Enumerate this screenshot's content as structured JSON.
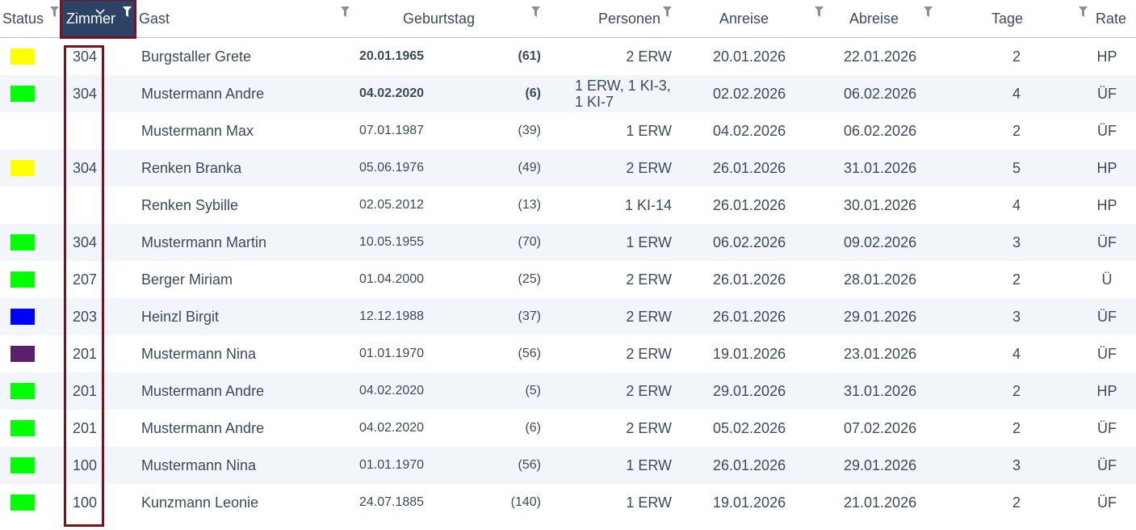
{
  "columns": {
    "status": "Status",
    "zimmer": "Zimmer",
    "gast": "Gast",
    "geburtstag": "Geburtstag",
    "personen": "Personen",
    "anreise": "Anreise",
    "abreise": "Abreise",
    "tage": "Tage",
    "rate": "Rate"
  },
  "icons": {
    "filter": "filter-icon",
    "sort": "chevron-down-icon"
  },
  "colors": {
    "header_active_bg": "#2b4466",
    "highlight_border": "#7a1020",
    "row_alt_bg": "#f2f5fa",
    "text": "#3c4a5c"
  },
  "rows": [
    {
      "status_color": "#ffff00",
      "zimmer": "304",
      "gast": "Burgstaller Grete",
      "geburtstag": "20.01.1965",
      "alter": "(61)",
      "personen": "2 ERW",
      "anreise": "20.01.2026",
      "abreise": "22.01.2026",
      "tage": "2",
      "rate": "HP",
      "bold": true
    },
    {
      "status_color": "#00ff00",
      "zimmer": "304",
      "gast": "Mustermann Andre",
      "geburtstag": "04.02.2020",
      "alter": "(6)",
      "personen": "1 ERW, 1 KI-3, 1 KI-7",
      "anreise": "02.02.2026",
      "abreise": "06.02.2026",
      "tage": "4",
      "rate": "ÜF",
      "bold": true
    },
    {
      "status_color": "",
      "zimmer": "",
      "gast": "Mustermann Max",
      "geburtstag": "07.01.1987",
      "alter": "(39)",
      "personen": "1 ERW",
      "anreise": "04.02.2026",
      "abreise": "06.02.2026",
      "tage": "2",
      "rate": "ÜF",
      "bold": false
    },
    {
      "status_color": "#ffff00",
      "zimmer": "304",
      "gast": "Renken Branka",
      "geburtstag": "05.06.1976",
      "alter": "(49)",
      "personen": "2 ERW",
      "anreise": "26.01.2026",
      "abreise": "31.01.2026",
      "tage": "5",
      "rate": "HP",
      "bold": false
    },
    {
      "status_color": "",
      "zimmer": "",
      "gast": "Renken Sybille",
      "geburtstag": "02.05.2012",
      "alter": "(13)",
      "personen": "1 KI-14",
      "anreise": "26.01.2026",
      "abreise": "30.01.2026",
      "tage": "4",
      "rate": "HP",
      "bold": false
    },
    {
      "status_color": "#00ff00",
      "zimmer": "304",
      "gast": "Mustermann Martin",
      "geburtstag": "10.05.1955",
      "alter": "(70)",
      "personen": "1 ERW",
      "anreise": "06.02.2026",
      "abreise": "09.02.2026",
      "tage": "3",
      "rate": "ÜF",
      "bold": false
    },
    {
      "status_color": "#00ff00",
      "zimmer": "207",
      "gast": "Berger Miriam",
      "geburtstag": "01.04.2000",
      "alter": "(25)",
      "personen": "2 ERW",
      "anreise": "26.01.2026",
      "abreise": "28.01.2026",
      "tage": "2",
      "rate": "Ü",
      "bold": false
    },
    {
      "status_color": "#0000ff",
      "zimmer": "203",
      "gast": "Heinzl Birgit",
      "geburtstag": "12.12.1988",
      "alter": "(37)",
      "personen": "2 ERW",
      "anreise": "26.01.2026",
      "abreise": "29.01.2026",
      "tage": "3",
      "rate": "ÜF",
      "bold": false
    },
    {
      "status_color": "#5c1f6e",
      "zimmer": "201",
      "gast": "Mustermann Nina",
      "geburtstag": "01.01.1970",
      "alter": "(56)",
      "personen": "2 ERW",
      "anreise": "19.01.2026",
      "abreise": "23.01.2026",
      "tage": "4",
      "rate": "ÜF",
      "bold": false
    },
    {
      "status_color": "#00ff00",
      "zimmer": "201",
      "gast": "Mustermann Andre",
      "geburtstag": "04.02.2020",
      "alter": "(5)",
      "personen": "2 ERW",
      "anreise": "29.01.2026",
      "abreise": "31.01.2026",
      "tage": "2",
      "rate": "HP",
      "bold": false
    },
    {
      "status_color": "#00ff00",
      "zimmer": "201",
      "gast": "Mustermann Andre",
      "geburtstag": "04.02.2020",
      "alter": "(6)",
      "personen": "2 ERW",
      "anreise": "05.02.2026",
      "abreise": "07.02.2026",
      "tage": "2",
      "rate": "ÜF",
      "bold": false
    },
    {
      "status_color": "#00ff00",
      "zimmer": "100",
      "gast": "Mustermann Nina",
      "geburtstag": "01.01.1970",
      "alter": "(56)",
      "personen": "1 ERW",
      "anreise": "26.01.2026",
      "abreise": "29.01.2026",
      "tage": "3",
      "rate": "ÜF",
      "bold": false
    },
    {
      "status_color": "#00ff00",
      "zimmer": "100",
      "gast": "Kunzmann Leonie",
      "geburtstag": "24.07.1885",
      "alter": "(140)",
      "personen": "1 ERW",
      "anreise": "19.01.2026",
      "abreise": "21.01.2026",
      "tage": "2",
      "rate": "ÜF",
      "bold": false
    }
  ]
}
